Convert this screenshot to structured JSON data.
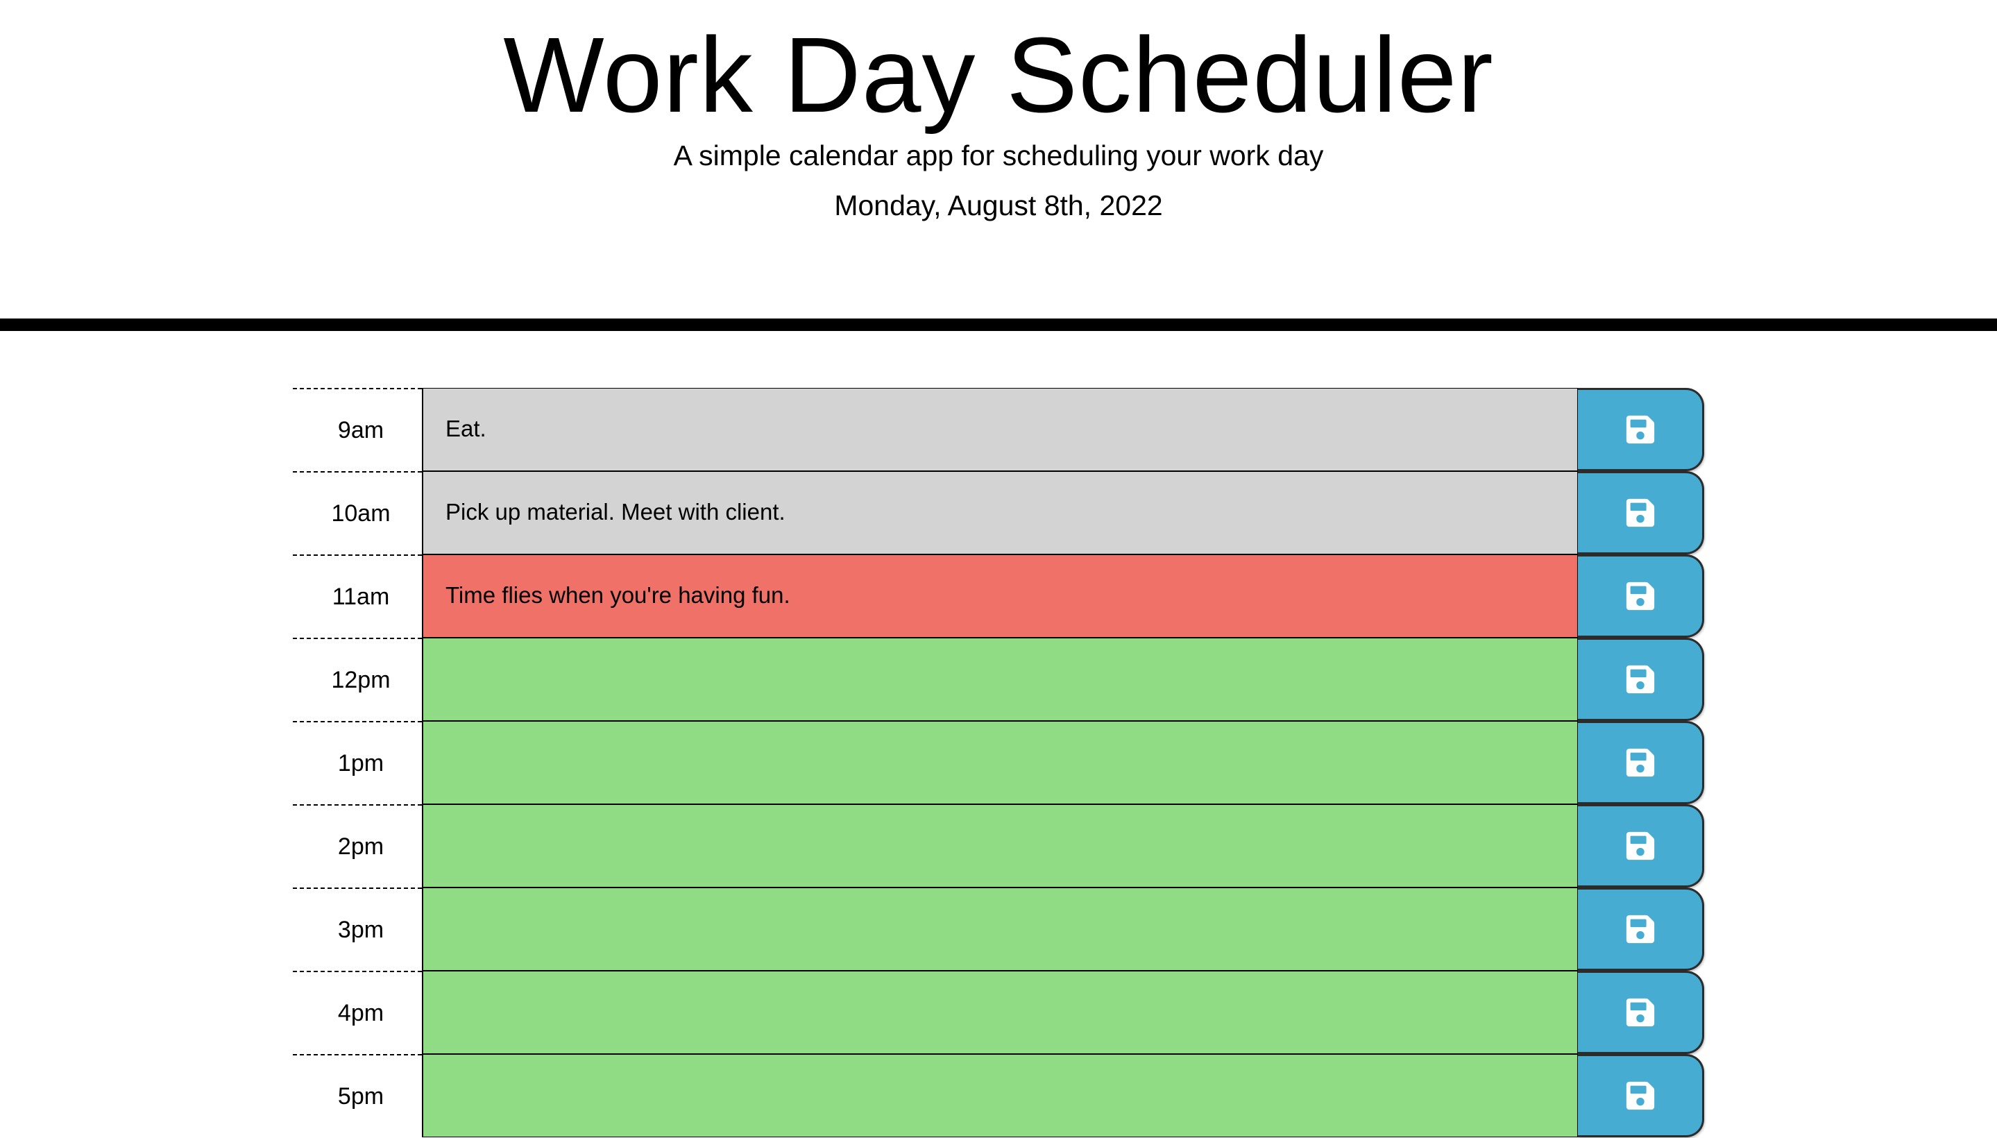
{
  "header": {
    "title": "Work Day Scheduler",
    "lead": "A simple calendar app for scheduling your work day",
    "current_day": "Monday, August 8th, 2022"
  },
  "colors": {
    "past": "#d3d3d3",
    "present": "#ef7168",
    "future": "#90dc84",
    "save_button": "#46acd2",
    "divider": "#000000"
  },
  "save_icon": "floppy-disk-icon",
  "time_blocks": [
    {
      "hour": "9am",
      "text": "Eat.",
      "status": "past"
    },
    {
      "hour": "10am",
      "text": "Pick up material. Meet with client.",
      "status": "past"
    },
    {
      "hour": "11am",
      "text": "Time flies when you're having fun.",
      "status": "present"
    },
    {
      "hour": "12pm",
      "text": "",
      "status": "future"
    },
    {
      "hour": "1pm",
      "text": "",
      "status": "future"
    },
    {
      "hour": "2pm",
      "text": "",
      "status": "future"
    },
    {
      "hour": "3pm",
      "text": "",
      "status": "future"
    },
    {
      "hour": "4pm",
      "text": "",
      "status": "future"
    },
    {
      "hour": "5pm",
      "text": "",
      "status": "future"
    }
  ]
}
